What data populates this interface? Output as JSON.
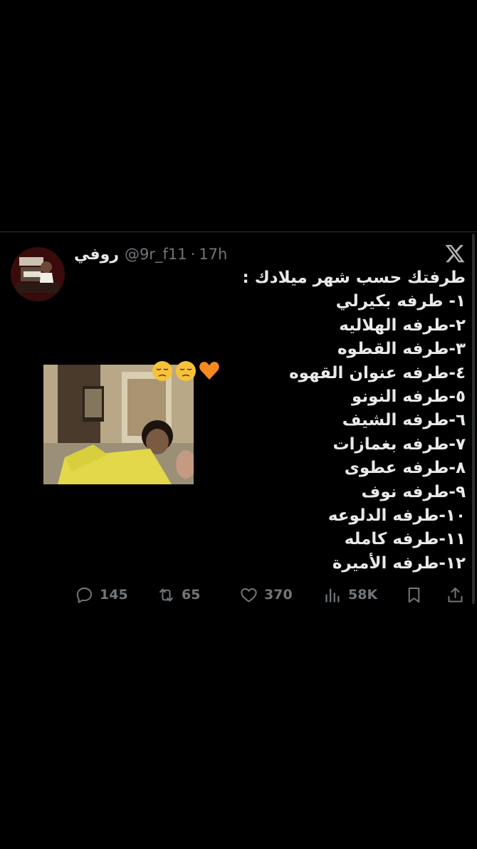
{
  "tweet": {
    "display_name": "روفي",
    "handle": "@9r_f11",
    "separator": "·",
    "time_ago": "17h",
    "lines": [
      "طرفتك حسب شهر ميلادك :",
      "١- طرفه بكيرلي",
      "٢-طرفه الهلاليه",
      "٣-طرفه القطوه",
      "٤-طرفه عنوان القهوه",
      "٥-طرفه النونو",
      "٦-طرفه الشيف",
      "٧-طرفه بغمازات",
      "٨-طرفه عطوى",
      "٩-طرفه نوف",
      "١٠-طرفه الدلوعه",
      "١١-طرفه كامله",
      "١٢-طرفه الأميرة"
    ]
  },
  "actions": {
    "replies": "145",
    "retweets": "65",
    "likes": "370",
    "views": "58K"
  },
  "icons": {
    "logo": "x-logo-icon",
    "reply": "reply-icon",
    "retweet": "retweet-icon",
    "like": "heart-icon",
    "views": "views-icon",
    "bookmark": "bookmark-icon",
    "share": "share-icon"
  },
  "colors": {
    "background": "#000000",
    "text": "#e7e9ea",
    "muted": "#71767b",
    "divider": "#2f3336"
  }
}
